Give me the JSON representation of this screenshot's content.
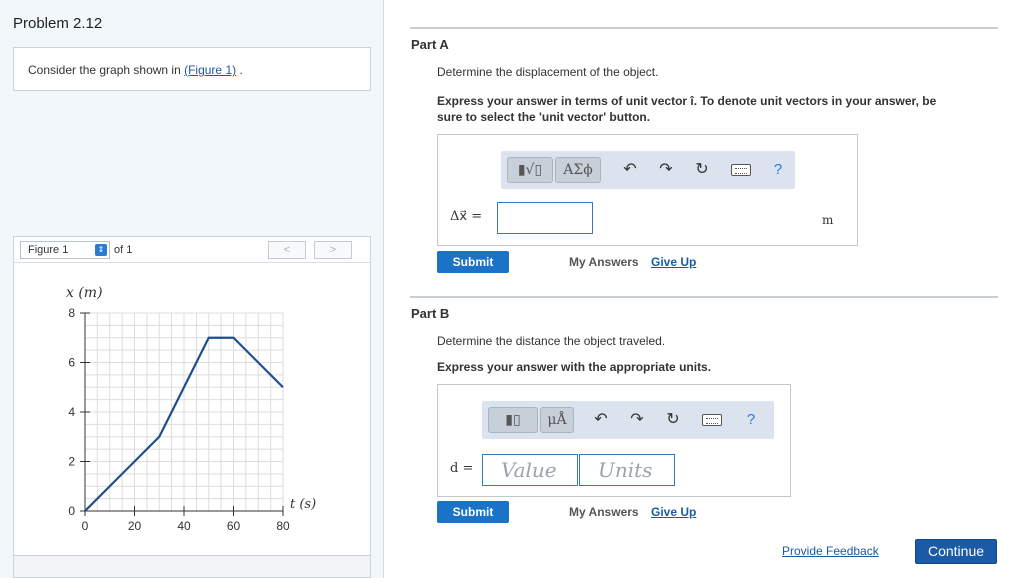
{
  "problem": {
    "title": "Problem 2.12",
    "consider_prefix": "Consider the graph shown in ",
    "consider_link": "(Figure 1)",
    "consider_suffix": " ."
  },
  "figure": {
    "select_label": "Figure 1",
    "of_label": "of 1",
    "prev": "<",
    "next": ">"
  },
  "chart_data": {
    "type": "line",
    "title": "",
    "xlabel": "t (s)",
    "ylabel": "x (m)",
    "xlim": [
      0,
      80
    ],
    "ylim": [
      0,
      8
    ],
    "x_ticks": [
      0,
      20,
      40,
      60,
      80
    ],
    "y_ticks": [
      0,
      2,
      4,
      6,
      8
    ],
    "grid": true,
    "color": "#1f4e8c",
    "x": [
      0,
      30,
      50,
      60,
      80
    ],
    "y": [
      0,
      3,
      7,
      7,
      5
    ]
  },
  "part_a": {
    "label": "Part A",
    "question": "Determine the displacement of the object.",
    "instruction_line1": "Express your answer in terms of unit vector î. To denote unit vectors in your answer, be",
    "instruction_line2": "sure to select the 'unit vector' button.",
    "toolbar_greek": "ΑΣϕ",
    "help": "?",
    "var_label": "Δx⃗ =",
    "unit": "m",
    "submit": "Submit",
    "my_answers": "My Answers",
    "give_up": "Give Up"
  },
  "part_b": {
    "label": "Part B",
    "question": "Determine the distance the object traveled.",
    "instruction": "Express your answer with the appropriate units.",
    "toolbar_unit": "μÅ",
    "help": "?",
    "var_label": "d =",
    "value_placeholder": "Value",
    "units_placeholder": "Units",
    "submit": "Submit",
    "my_answers": "My Answers",
    "give_up": "Give Up"
  },
  "footer": {
    "feedback": "Provide Feedback",
    "continue": "Continue"
  }
}
